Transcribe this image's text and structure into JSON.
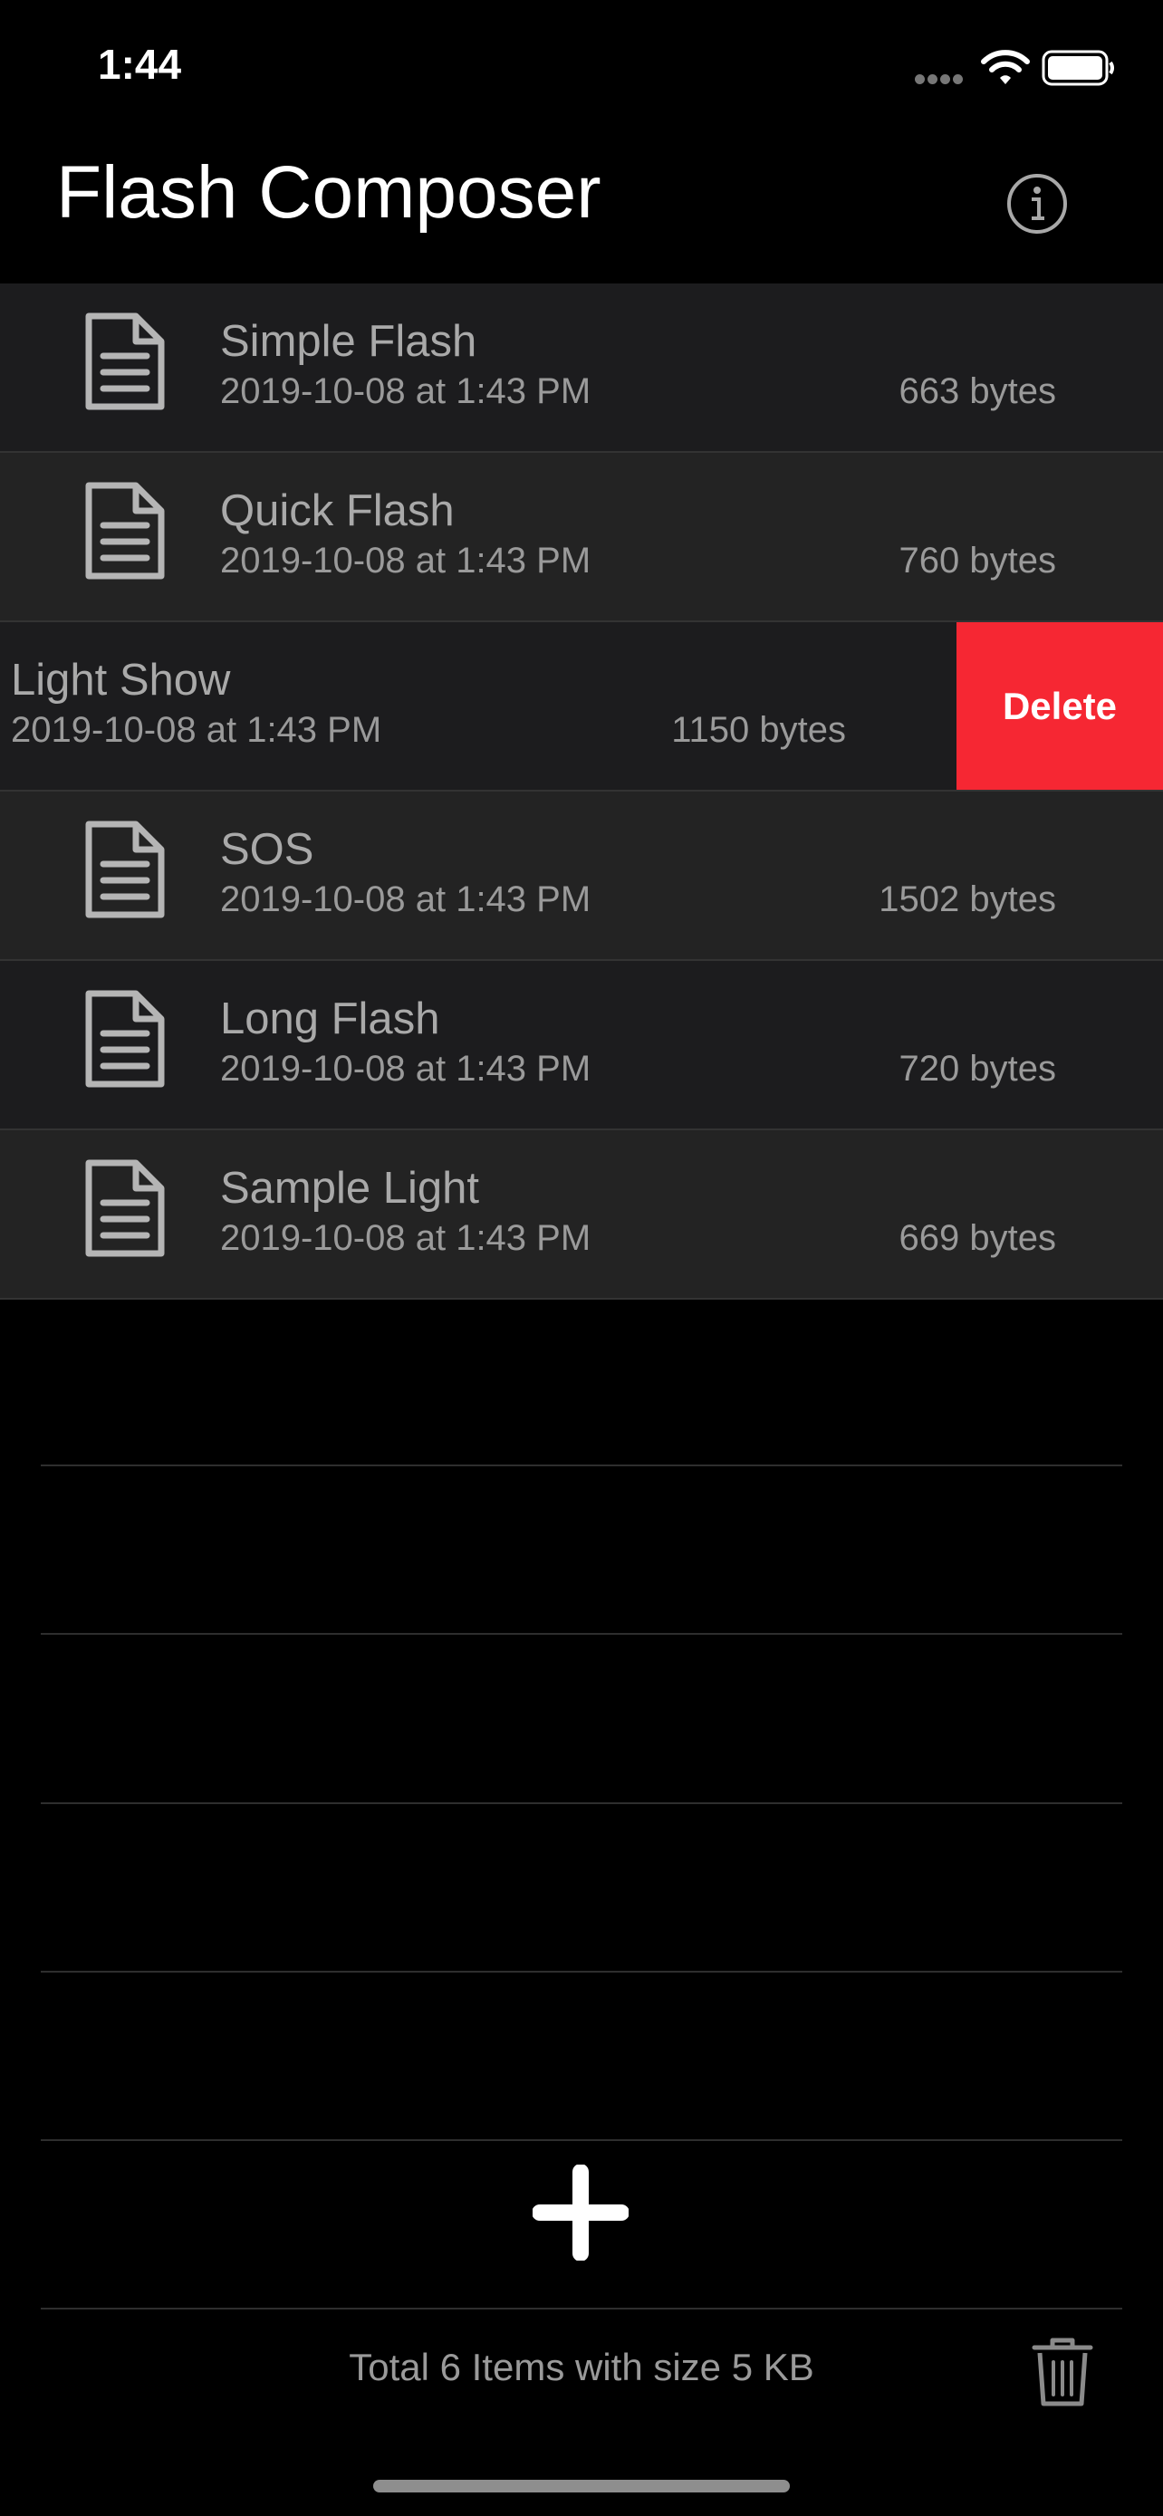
{
  "status_bar": {
    "time": "1:44"
  },
  "header": {
    "title": "Flash Composer",
    "info_icon": "info-circle-icon"
  },
  "items": [
    {
      "title": "Simple Flash",
      "date": "2019-10-08 at 1:43 PM",
      "size": "663 bytes"
    },
    {
      "title": "Quick Flash",
      "date": "2019-10-08 at 1:43 PM",
      "size": "760 bytes"
    },
    {
      "title": "Light Show",
      "date": "2019-10-08 at 1:43 PM",
      "size": "1150 bytes"
    },
    {
      "title": "SOS",
      "date": "2019-10-08 at 1:43 PM",
      "size": "1502 bytes"
    },
    {
      "title": "Long Flash",
      "date": "2019-10-08 at 1:43 PM",
      "size": "720 bytes"
    },
    {
      "title": "Sample Light",
      "date": "2019-10-08 at 1:43 PM",
      "size": "669 bytes"
    }
  ],
  "swipe_action": {
    "label": "Delete",
    "color": "#f62733"
  },
  "footer": {
    "summary": "Total 6 Items with size 5 KB",
    "add_icon": "plus-icon",
    "trash_icon": "trash-icon"
  }
}
